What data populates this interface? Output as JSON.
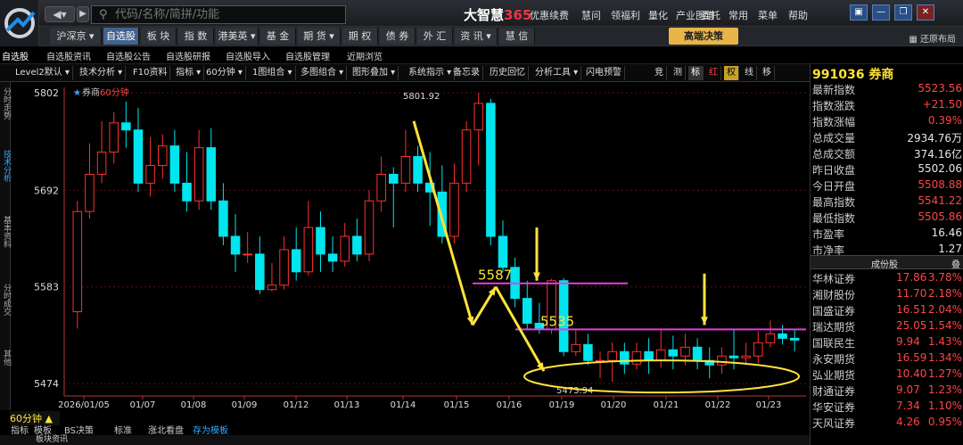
{
  "app": {
    "brand": "大智慧",
    "brand_num": "365"
  },
  "search": {
    "placeholder": "代码/名称/简拼/功能"
  },
  "menus": [
    "优惠续费",
    "慧问",
    "领福利",
    "量化",
    "产业图谱",
    "委托",
    "常用",
    "菜单",
    "帮助"
  ],
  "tabs": [
    {
      "label": "沪深京 ▾",
      "active": false
    },
    {
      "label": "自选股",
      "active": true
    },
    {
      "label": "板 块",
      "active": false
    },
    {
      "label": "指 数",
      "active": false
    },
    {
      "label": "港美英 ▾",
      "active": false
    },
    {
      "label": "基 金",
      "active": false
    },
    {
      "label": "期 货 ▾",
      "active": false
    },
    {
      "label": "期 权",
      "active": false
    },
    {
      "label": "债 券",
      "active": false
    },
    {
      "label": "外 汇",
      "active": false
    },
    {
      "label": "资 讯 ▾",
      "active": false
    },
    {
      "label": "慧 信",
      "active": false
    }
  ],
  "gaoduan": "高端决策",
  "restore_layout": "还原布局",
  "subtabs": [
    "自选股",
    "自选股资讯",
    "自选股公告",
    "自选股研报",
    "自选股导入",
    "自选股管理",
    "近期浏览"
  ],
  "tools": [
    "Level2默认 ▾",
    "技术分析 ▾",
    "F10资料",
    "指标 ▾",
    "60分钟 ▾",
    "1图组合 ▾",
    "多图组合 ▾",
    "图形叠加 ▾",
    "系统指示 ▾",
    "备忘录",
    "历史回忆",
    "分析工具 ▾",
    "闪电预警",
    "竞",
    "测",
    "标",
    "红",
    "权",
    "线",
    "移"
  ],
  "rail": [
    "分时走势",
    "技术分析",
    "基本资料",
    "分时成交",
    "其他"
  ],
  "chart_legend": {
    "name": "券商",
    "period": "60分钟"
  },
  "quote": {
    "title": "991036 券商",
    "rows": [
      {
        "k": "最新指数",
        "v": "5523.56",
        "cls": "red"
      },
      {
        "k": "指数涨跌",
        "v": "+21.50",
        "cls": "red"
      },
      {
        "k": "指数涨幅",
        "v": "0.39%",
        "cls": "red"
      },
      {
        "k": "总成交量",
        "v": "2934.76万",
        "cls": "white"
      },
      {
        "k": "总成交额",
        "v": "374.16亿",
        "cls": "white"
      },
      {
        "k": "昨日收盘",
        "v": "5502.06",
        "cls": "white"
      },
      {
        "k": "今日开盘",
        "v": "5508.88",
        "cls": "red"
      },
      {
        "k": "最高指数",
        "v": "5541.22",
        "cls": "red"
      },
      {
        "k": "最低指数",
        "v": "5505.86",
        "cls": "red"
      },
      {
        "k": "市盈率",
        "v": "16.46",
        "cls": "white"
      },
      {
        "k": "市净率",
        "v": "1.27",
        "cls": "white"
      }
    ],
    "comp_title": "成份股",
    "comp_btn": "叠",
    "stocks": [
      {
        "n": "华林证券",
        "p": "17.86",
        "c": "3.78%"
      },
      {
        "n": "湘财股份",
        "p": "11.70",
        "c": "2.18%"
      },
      {
        "n": "国盛证券",
        "p": "16.51",
        "c": "2.04%"
      },
      {
        "n": "瑞达期货",
        "p": "25.05",
        "c": "1.54%"
      },
      {
        "n": "国联民生",
        "p": "9.94",
        "c": "1.43%"
      },
      {
        "n": "永安期货",
        "p": "16.59",
        "c": "1.34%"
      },
      {
        "n": "弘业期货",
        "p": "10.40",
        "c": "1.27%"
      },
      {
        "n": "财通证券",
        "p": "9.07",
        "c": "1.23%"
      },
      {
        "n": "华安证券",
        "p": "7.34",
        "c": "1.10%"
      },
      {
        "n": "天风证券",
        "p": "4.26",
        "c": "0.95%"
      }
    ]
  },
  "bottom": {
    "period": "60分钟",
    "tabs": [
      "指标",
      "模板",
      "BS决策",
      "标准",
      "涨北看盘",
      "存为模板"
    ],
    "sub": "板块资讯"
  },
  "chart_data": {
    "type": "candlestick",
    "yticks": [
      5802,
      5692,
      5583,
      5474
    ],
    "ylim": [
      5460,
      5808
    ],
    "xlabels": [
      "2026/01/05",
      "01/07",
      "01/08",
      "01/09",
      "01/12",
      "01/13",
      "01/14",
      "01/15",
      "01/16",
      "01/19",
      "01/20",
      "01/21",
      "01/22",
      "01/23"
    ],
    "high_label": "5801.92",
    "low_label": "5473.94",
    "annotations": [
      {
        "text": "5587",
        "value": 5587
      },
      {
        "text": "5535",
        "value": 5535
      }
    ],
    "candles": [
      [
        5555,
        5668,
        5536,
        5680
      ],
      [
        5668,
        5710,
        5660,
        5745
      ],
      [
        5710,
        5735,
        5700,
        5770
      ],
      [
        5735,
        5768,
        5722,
        5780
      ],
      [
        5768,
        5760,
        5740,
        5792
      ],
      [
        5760,
        5700,
        5690,
        5785
      ],
      [
        5700,
        5720,
        5685,
        5752
      ],
      [
        5720,
        5742,
        5705,
        5755
      ],
      [
        5742,
        5700,
        5690,
        5760
      ],
      [
        5700,
        5680,
        5668,
        5735
      ],
      [
        5680,
        5740,
        5670,
        5760
      ],
      [
        5740,
        5680,
        5670,
        5762
      ],
      [
        5680,
        5640,
        5630,
        5700
      ],
      [
        5640,
        5620,
        5600,
        5665
      ],
      [
        5620,
        5620,
        5610,
        5645
      ],
      [
        5620,
        5580,
        5575,
        5640
      ],
      [
        5580,
        5585,
        5578,
        5610
      ],
      [
        5585,
        5625,
        5580,
        5640
      ],
      [
        5625,
        5600,
        5590,
        5650
      ],
      [
        5600,
        5650,
        5596,
        5680
      ],
      [
        5650,
        5620,
        5600,
        5668
      ],
      [
        5620,
        5612,
        5600,
        5640
      ],
      [
        5612,
        5640,
        5606,
        5655
      ],
      [
        5640,
        5620,
        5612,
        5660
      ],
      [
        5620,
        5680,
        5612,
        5692
      ],
      [
        5680,
        5710,
        5668,
        5730
      ],
      [
        5710,
        5700,
        5650,
        5718
      ],
      [
        5700,
        5730,
        5690,
        5760
      ],
      [
        5730,
        5700,
        5690,
        5742
      ],
      [
        5700,
        5690,
        5652,
        5735
      ],
      [
        5690,
        5640,
        5632,
        5720
      ],
      [
        5640,
        5700,
        5632,
        5722
      ],
      [
        5700,
        5760,
        5690,
        5770
      ],
      [
        5760,
        5790,
        5720,
        5802
      ],
      [
        5790,
        5640,
        5630,
        5795
      ],
      [
        5640,
        5605,
        5600,
        5658
      ],
      [
        5605,
        5570,
        5560,
        5616
      ],
      [
        5570,
        5542,
        5535,
        5590
      ],
      [
        5542,
        5535,
        5530,
        5565
      ],
      [
        5535,
        5590,
        5530,
        5592
      ],
      [
        5590,
        5510,
        5505,
        5593
      ],
      [
        5510,
        5518,
        5505,
        5535
      ],
      [
        5518,
        5500,
        5495,
        5530
      ],
      [
        5500,
        5500,
        5480,
        5510
      ],
      [
        5500,
        5510,
        5476,
        5520
      ],
      [
        5510,
        5496,
        5485,
        5520
      ],
      [
        5496,
        5510,
        5490,
        5520
      ],
      [
        5510,
        5500,
        5485,
        5525
      ],
      [
        5500,
        5512,
        5492,
        5535
      ],
      [
        5512,
        5505,
        5490,
        5528
      ],
      [
        5505,
        5515,
        5495,
        5530
      ],
      [
        5515,
        5500,
        5490,
        5525
      ],
      [
        5500,
        5495,
        5480,
        5515
      ],
      [
        5495,
        5505,
        5485,
        5515
      ],
      [
        5505,
        5503,
        5490,
        5535
      ],
      [
        5503,
        5505,
        5495,
        5520
      ],
      [
        5505,
        5520,
        5497,
        5533
      ],
      [
        5520,
        5530,
        5515,
        5545
      ],
      [
        5530,
        5525,
        5518,
        5540
      ],
      [
        5525,
        5523,
        5510,
        5535
      ]
    ]
  }
}
